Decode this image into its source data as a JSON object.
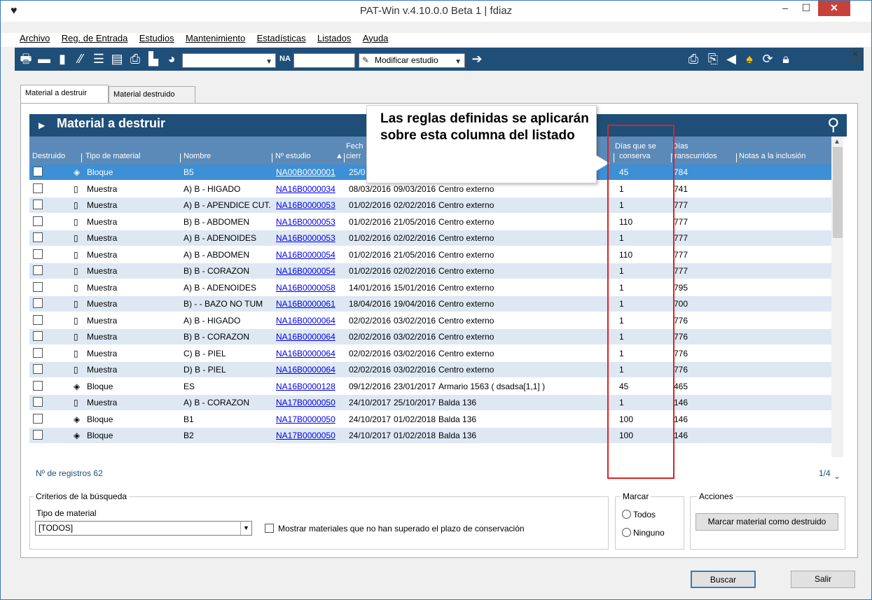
{
  "window": {
    "title": "PAT-Win v.4.10.0.0 Beta 1 | fdiaz",
    "app_icon": "heart-monitor-icon",
    "minimize": "–",
    "maximize": "☐",
    "close": "✕"
  },
  "menu": [
    "Archivo",
    "Reg. de Entrada",
    "Estudios",
    "Mantenimiento",
    "Estadísticas",
    "Listados",
    "Ayuda"
  ],
  "toolbar": {
    "na_label": "NA",
    "action_value": "Modificar estudio",
    "icons": [
      "inbox-icon",
      "printer-icon",
      "book-icon",
      "tools-icon",
      "list-icon",
      "clipboard-icon",
      "print-icon",
      "file-icon",
      "pie-chart-icon",
      "print-right-icon",
      "export-icon",
      "speaker-icon",
      "bell-icon",
      "sync-icon",
      "lock-icon"
    ]
  },
  "tabs": [
    "Material a destruir",
    "Material destruido"
  ],
  "grid": {
    "title": "Material a destruir",
    "columns": {
      "destruido": "Destruido",
      "tipo": "Tipo de material",
      "nombre": "Nombre",
      "nestudio": "Nº estudio",
      "fecha_line1": "Fech",
      "fecha_line2": "cierr",
      "dias_conserva_line1": "Días que se",
      "dias_conserva_line2": "conserva",
      "dias_trans_line1": "Días",
      "dias_trans_line2": "transcurridos",
      "notas": "Notas a la inclusión"
    },
    "rows": [
      {
        "tipo": "Bloque",
        "icon": "block-icon",
        "nombre": "B5",
        "estudio": "NA00B0000001",
        "fecha1": "25/0",
        "fecha2": "",
        "ubicacion": "",
        "dias": "45",
        "trans": "784",
        "selected": true
      },
      {
        "tipo": "Muestra",
        "icon": "sample-icon",
        "nombre": "A) B  - HIGADO",
        "estudio": "NA16B0000034",
        "fecha1": "08/03/2016",
        "fecha2": "09/03/2016",
        "ubicacion": "Centro externo",
        "dias": "1",
        "trans": "741"
      },
      {
        "tipo": "Muestra",
        "icon": "sample-icon",
        "nombre": "A) B - APENDICE CUT.",
        "estudio": "NA16B0000053",
        "fecha1": "01/02/2016",
        "fecha2": "02/02/2016",
        "ubicacion": "Centro externo",
        "dias": "1",
        "trans": "777"
      },
      {
        "tipo": "Muestra",
        "icon": "sample-icon",
        "nombre": "B) B - ABDOMEN",
        "estudio": "NA16B0000053",
        "fecha1": "01/02/2016",
        "fecha2": "21/05/2016",
        "ubicacion": "Centro externo",
        "dias": "110",
        "trans": "777"
      },
      {
        "tipo": "Muestra",
        "icon": "sample-icon",
        "nombre": "A) B - ADENOIDES",
        "estudio": "NA16B0000053",
        "fecha1": "01/02/2016",
        "fecha2": "02/02/2016",
        "ubicacion": "Centro externo",
        "dias": "1",
        "trans": "777"
      },
      {
        "tipo": "Muestra",
        "icon": "sample-icon",
        "nombre": "A) B  - ABDOMEN",
        "estudio": "NA16B0000054",
        "fecha1": "01/02/2016",
        "fecha2": "21/05/2016",
        "ubicacion": "Centro externo",
        "dias": "110",
        "trans": "777"
      },
      {
        "tipo": "Muestra",
        "icon": "sample-icon",
        "nombre": "B) B  - CORAZON",
        "estudio": "NA16B0000054",
        "fecha1": "01/02/2016",
        "fecha2": "02/02/2016",
        "ubicacion": "Centro externo",
        "dias": "1",
        "trans": "777"
      },
      {
        "tipo": "Muestra",
        "icon": "sample-icon",
        "nombre": "A) B - ADENOIDES",
        "estudio": "NA16B0000058",
        "fecha1": "14/01/2016",
        "fecha2": "15/01/2016",
        "ubicacion": "Centro externo",
        "dias": "1",
        "trans": "795"
      },
      {
        "tipo": "Muestra",
        "icon": "sample-icon",
        "nombre": "B) -  - BAZO NO TUM",
        "estudio": "NA16B0000061",
        "fecha1": "18/04/2016",
        "fecha2": "19/04/2016",
        "ubicacion": "Centro externo",
        "dias": "1",
        "trans": "700"
      },
      {
        "tipo": "Muestra",
        "icon": "sample-icon",
        "nombre": "A) B - HIGADO",
        "estudio": "NA16B0000064",
        "fecha1": "02/02/2016",
        "fecha2": "03/02/2016",
        "ubicacion": "Centro externo",
        "dias": "1",
        "trans": "776"
      },
      {
        "tipo": "Muestra",
        "icon": "sample-icon",
        "nombre": "B) B - CORAZON",
        "estudio": "NA16B0000064",
        "fecha1": "02/02/2016",
        "fecha2": "03/02/2016",
        "ubicacion": "Centro externo",
        "dias": "1",
        "trans": "776"
      },
      {
        "tipo": "Muestra",
        "icon": "sample-icon",
        "nombre": "C) B - PIEL",
        "estudio": "NA16B0000064",
        "fecha1": "02/02/2016",
        "fecha2": "03/02/2016",
        "ubicacion": "Centro externo",
        "dias": "1",
        "trans": "776"
      },
      {
        "tipo": "Muestra",
        "icon": "sample-icon",
        "nombre": "D) B - PIEL",
        "estudio": "NA16B0000064",
        "fecha1": "02/02/2016",
        "fecha2": "03/02/2016",
        "ubicacion": "Centro externo",
        "dias": "1",
        "trans": "776"
      },
      {
        "tipo": "Bloque",
        "icon": "block-icon",
        "nombre": "ES",
        "estudio": "NA16B0000128",
        "fecha1": "09/12/2016",
        "fecha2": "23/01/2017",
        "ubicacion": "Armario 1563 ( dsadsa[1,1]  )",
        "dias": "45",
        "trans": "465"
      },
      {
        "tipo": "Muestra",
        "icon": "sample-icon",
        "nombre": "A) B - CORAZON",
        "estudio": "NA17B0000050",
        "fecha1": "24/10/2017",
        "fecha2": "25/10/2017",
        "ubicacion": "Balda 136",
        "dias": "1",
        "trans": "146"
      },
      {
        "tipo": "Bloque",
        "icon": "block-icon",
        "nombre": "B1",
        "estudio": "NA17B0000050",
        "fecha1": "24/10/2017",
        "fecha2": "01/02/2018",
        "ubicacion": "Balda 136",
        "dias": "100",
        "trans": "146"
      },
      {
        "tipo": "Bloque",
        "icon": "block-icon",
        "nombre": "B2",
        "estudio": "NA17B0000050",
        "fecha1": "24/10/2017",
        "fecha2": "01/02/2018",
        "ubicacion": "Balda 136",
        "dias": "100",
        "trans": "146"
      }
    ],
    "record_count": "Nº de registros 62",
    "page": "1/4"
  },
  "callout": {
    "text": "Las reglas definidas se aplicarán sobre esta columna del listado"
  },
  "criteria": {
    "legend": "Criterios de la búsqueda",
    "tipo_label": "Tipo de material",
    "tipo_value": "[TODOS]",
    "checkbox_label": "Mostrar materiales que no han superado el plazo de conservación"
  },
  "marcar": {
    "legend": "Marcar",
    "todos": "Todos",
    "ninguno": "Ninguno"
  },
  "acciones": {
    "legend": "Acciones",
    "button": "Marcar material como destruido"
  },
  "footer": {
    "buscar": "Buscar",
    "salir": "Salir"
  }
}
